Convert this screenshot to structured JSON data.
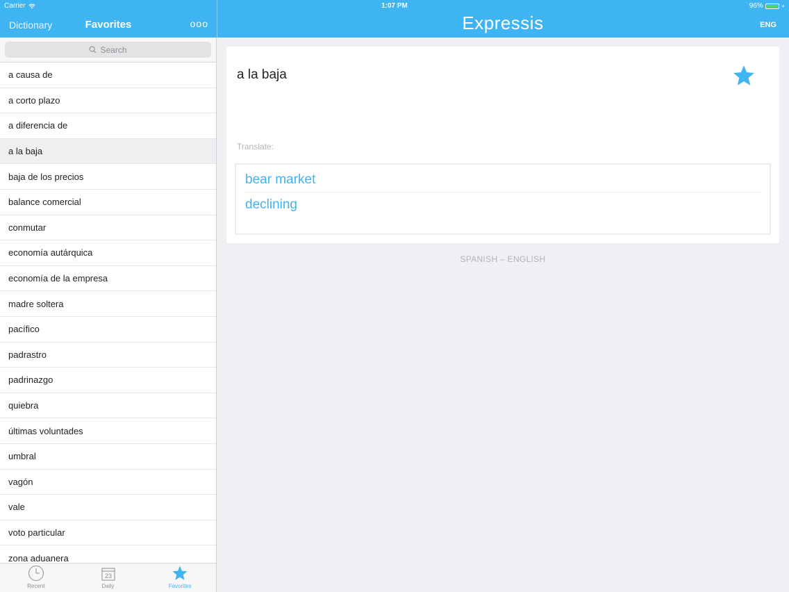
{
  "status": {
    "carrier": "Carrier",
    "time": "1:07 PM",
    "battery_percent": "96%",
    "battery_level": 0.96
  },
  "header": {
    "dictionary_label": "Dictionary",
    "favorites_title": "Favorites",
    "more_label": "ooo",
    "app_title": "Expressis",
    "language_button": "ENG",
    "accent_color": "#3fb4f2"
  },
  "sidebar": {
    "search_placeholder": "Search",
    "items": [
      "a causa de",
      "a corto plazo",
      "a diferencia de",
      "a la baja",
      "baja de los precios",
      "balance comercial",
      "conmutar",
      "economía autárquica",
      "economía de la empresa",
      "madre soltera",
      "pacífico",
      "padrastro",
      "padrinazgo",
      "quiebra",
      "últimas voluntades",
      "umbral",
      "vagón",
      "vale",
      "voto particular",
      "zona aduanera"
    ],
    "selected_index": 3
  },
  "tabs": [
    {
      "label": "Recent",
      "icon": "clock-icon"
    },
    {
      "label": "Daily",
      "icon": "calendar-icon",
      "date": "23"
    },
    {
      "label": "Favorites",
      "icon": "star-icon",
      "active": true
    }
  ],
  "detail": {
    "phrase": "a la baja",
    "translate_label": "Translate:",
    "translations": [
      "bear market",
      "declining"
    ],
    "language_pair": "SPANISH – ENGLISH"
  }
}
